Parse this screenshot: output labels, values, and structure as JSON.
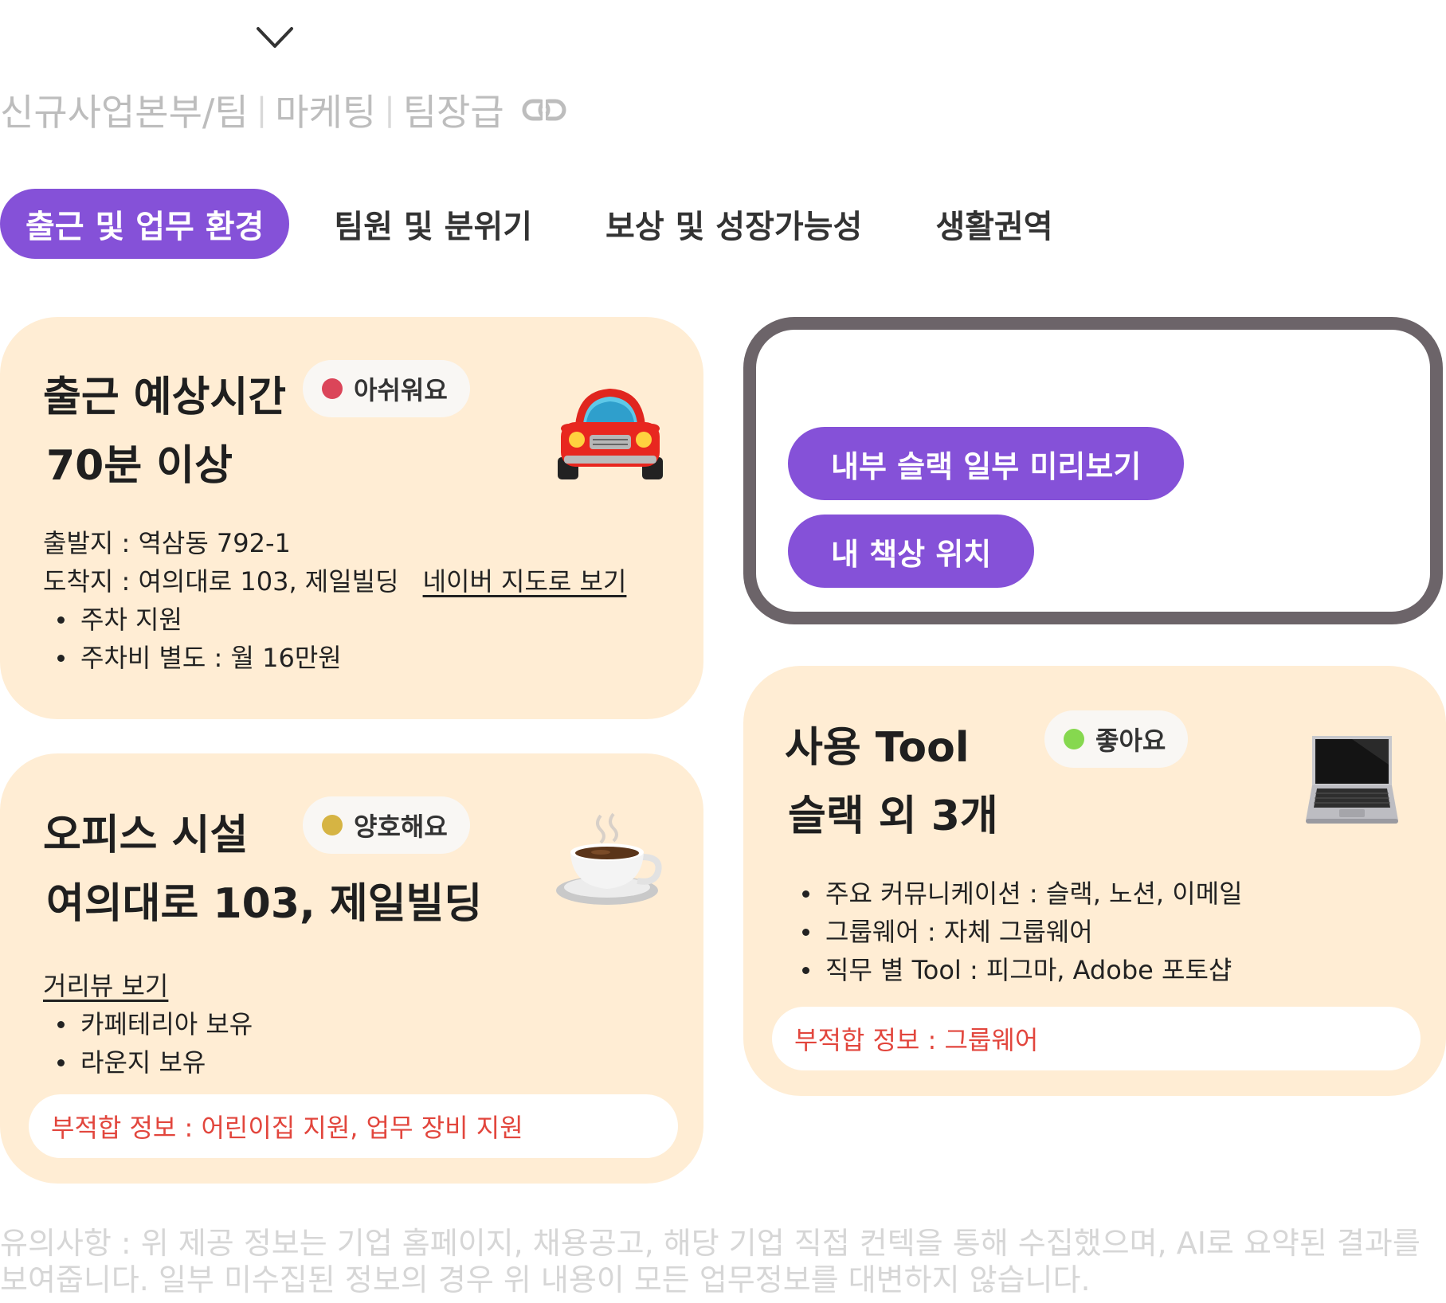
{
  "breadcrumb": {
    "part1": "신규사업본부/팀",
    "separator": "|",
    "part2": "마케팅",
    "part3": "팀장급"
  },
  "tabs": [
    {
      "label": "출근 및 업무 환경",
      "active": true
    },
    {
      "label": "팀원 및 분위기",
      "active": false
    },
    {
      "label": "보상 및 성장가능성",
      "active": false
    },
    {
      "label": "생활권역",
      "active": false
    }
  ],
  "commute": {
    "title": "출근 예상시간",
    "value": "70분 이상",
    "badge": {
      "label": "아쉬워요",
      "color": "#db4559"
    },
    "icon": "car-icon",
    "departure": "출발지 : 역삼동 792-1",
    "arrival": "도착지 : 여의대로 103, 제일빌딩",
    "map_link": "네이버 지도로 보기",
    "bullets": [
      "주차 지원",
      "주차비 별도 : 월 16만원"
    ]
  },
  "preview": {
    "slack_button": "내부 슬랙 일부 미리보기",
    "desk_button": "내 책상 위치"
  },
  "office": {
    "title": "오피스 시설",
    "value": "여의대로 103, 제일빌딩",
    "badge": {
      "label": "양호해요",
      "color": "#d6b443"
    },
    "icon": "coffee-icon",
    "street_view_link": "거리뷰 보기",
    "bullets": [
      "카페테리아 보유",
      "라운지 보유"
    ],
    "warning": "부적합 정보 : 어린이집 지원, 업무 장비 지원"
  },
  "tools": {
    "title": "사용 Tool",
    "value": "슬랙 외 3개",
    "badge": {
      "label": "좋아요",
      "color": "#86d84f"
    },
    "icon": "laptop-icon",
    "bullets": [
      "주요 커뮤니케이션 : 슬랙, 노션, 이메일",
      "그룹웨어 : 자체 그룹웨어",
      "직무 별 Tool : 피그마, Adobe 포토샵"
    ],
    "warning": "부적합 정보 : 그룹웨어"
  },
  "notice": "유의사항 : 위 제공 정보는 기업 홈페이지, 채용공고, 해당 기업 직접 컨텍을 통해 수집했으며, AI로 요약된 결과를 보여줍니다. 일부 미수집된 정보의 경우 위 내용이 모든 업무정보를 대변하지 않습니다."
}
